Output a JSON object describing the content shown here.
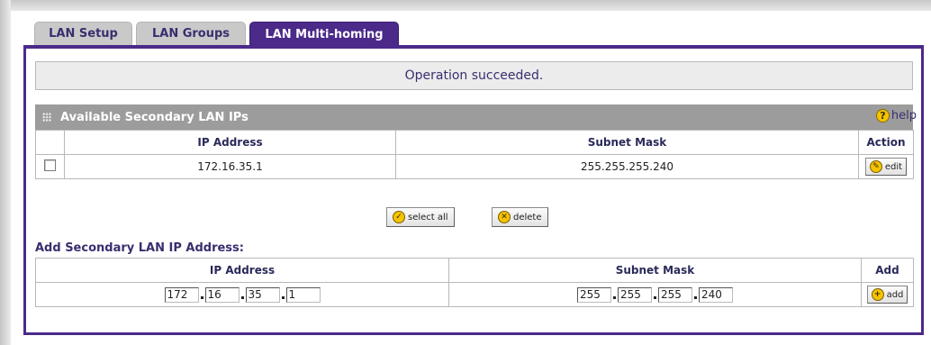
{
  "tabs": [
    {
      "label": "LAN Setup"
    },
    {
      "label": "LAN Groups"
    },
    {
      "label": "LAN Multi-homing"
    }
  ],
  "status_message": "Operation succeeded.",
  "available_section": {
    "title": "Available Secondary LAN IPs",
    "help_label": "help",
    "columns": {
      "ip": "IP Address",
      "mask": "Subnet Mask",
      "action": "Action"
    },
    "rows": [
      {
        "ip": "172.16.35.1",
        "mask": "255.255.255.240",
        "action_label": "edit"
      }
    ]
  },
  "buttons": {
    "select_all": "select all",
    "delete": "delete"
  },
  "add_section": {
    "title": "Add Secondary LAN IP Address:",
    "columns": {
      "ip": "IP Address",
      "mask": "Subnet Mask",
      "add": "Add"
    },
    "ip_octets": [
      "172",
      "16",
      "35",
      "1"
    ],
    "mask_octets": [
      "255",
      "255",
      "255",
      "240"
    ],
    "add_label": "add"
  },
  "colors": {
    "accent": "#4b2a8a",
    "header_gray": "#9c9c9c",
    "icon_yellow": "#f4c400"
  }
}
